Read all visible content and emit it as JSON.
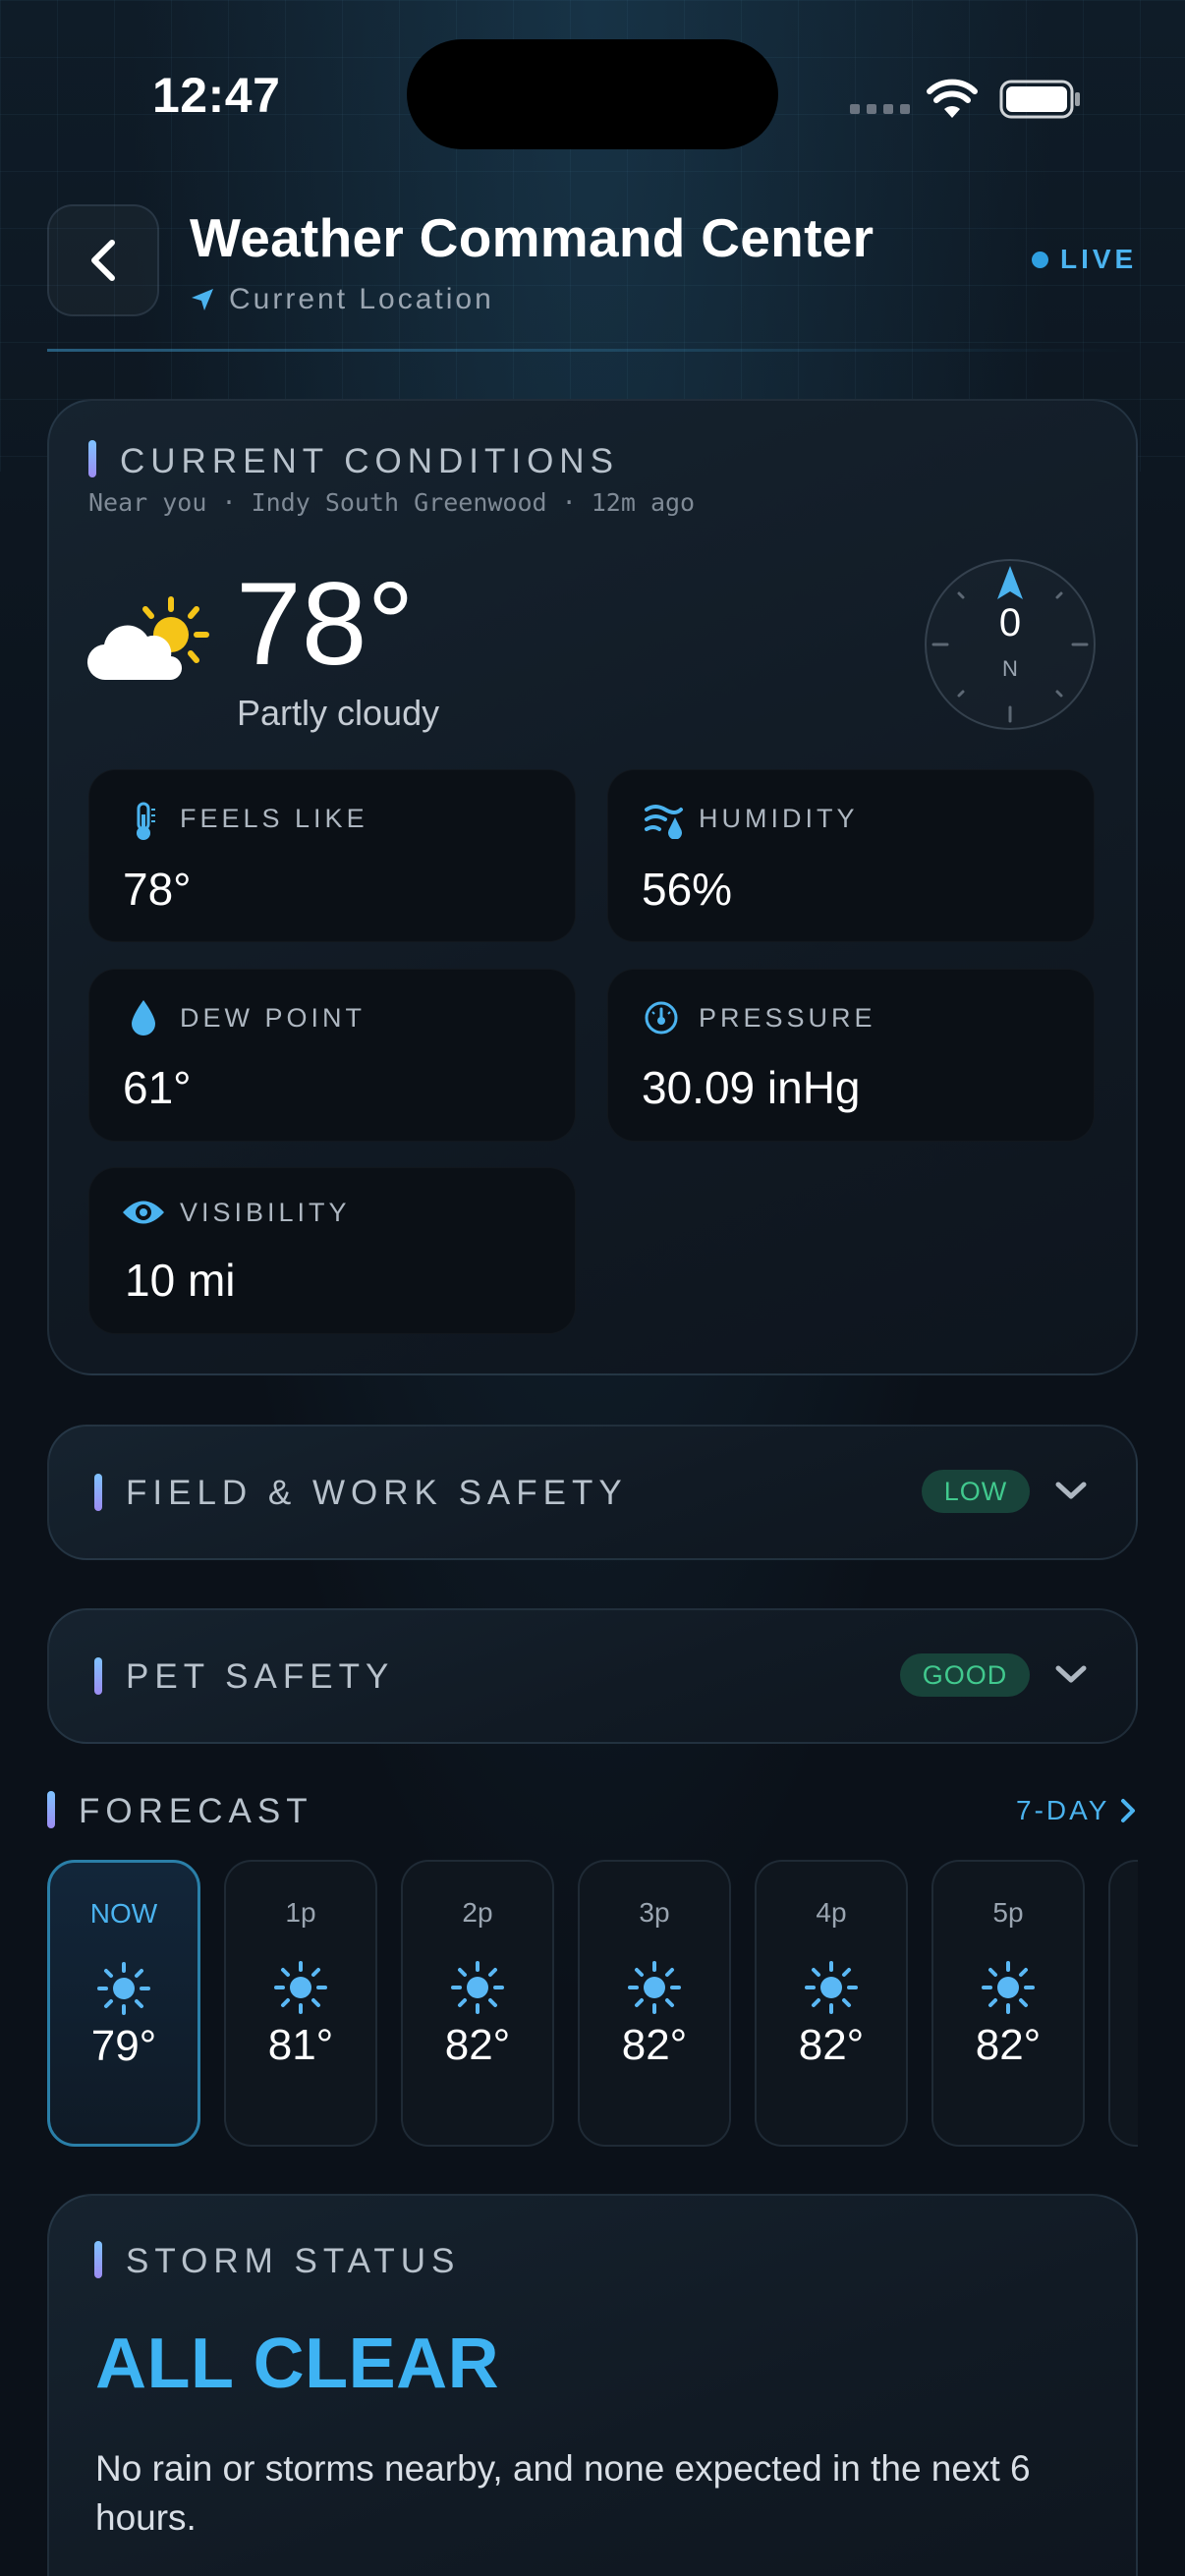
{
  "status_bar": {
    "time": "12:47"
  },
  "header": {
    "title": "Weather Command Center",
    "location": "Current Location",
    "live_label": "LIVE"
  },
  "current": {
    "section_title": "CURRENT CONDITIONS",
    "subtitle": "Near you · Indy South Greenwood · 12m ago",
    "temperature": "78°",
    "condition": "Partly cloudy",
    "wind_speed": "0",
    "wind_dir": "N",
    "metrics": {
      "feels_like": {
        "label": "FEELS LIKE",
        "value": "78°",
        "icon": "thermometer-icon"
      },
      "humidity": {
        "label": "HUMIDITY",
        "value": "56%",
        "icon": "humidity-icon"
      },
      "dew_point": {
        "label": "DEW POINT",
        "value": "61°",
        "icon": "droplet-icon"
      },
      "pressure": {
        "label": "PRESSURE",
        "value": "30.09 inHg",
        "icon": "gauge-icon"
      },
      "visibility": {
        "label": "VISIBILITY",
        "value": "10 mi",
        "icon": "eye-icon"
      }
    }
  },
  "field_safety": {
    "title": "FIELD & WORK SAFETY",
    "badge": "LOW"
  },
  "pet_safety": {
    "title": "PET SAFETY",
    "badge": "GOOD"
  },
  "forecast": {
    "title": "FORECAST",
    "link": "7-DAY",
    "hours": [
      {
        "time": "NOW",
        "temp": "79°",
        "icon": "sun-icon"
      },
      {
        "time": "1p",
        "temp": "81°",
        "icon": "sun-icon"
      },
      {
        "time": "2p",
        "temp": "82°",
        "icon": "sun-icon"
      },
      {
        "time": "3p",
        "temp": "82°",
        "icon": "sun-icon"
      },
      {
        "time": "4p",
        "temp": "82°",
        "icon": "sun-icon"
      },
      {
        "time": "5p",
        "temp": "82°",
        "icon": "sun-icon"
      }
    ]
  },
  "storm": {
    "title": "STORM STATUS",
    "headline": "ALL CLEAR",
    "text": "No rain or storms nearby, and none expected in the next 6 hours."
  },
  "colors": {
    "accent": "#4bb3ef",
    "background": "#0b1119",
    "good_green": "#41c98e",
    "sun_yellow": "#f5c518"
  }
}
